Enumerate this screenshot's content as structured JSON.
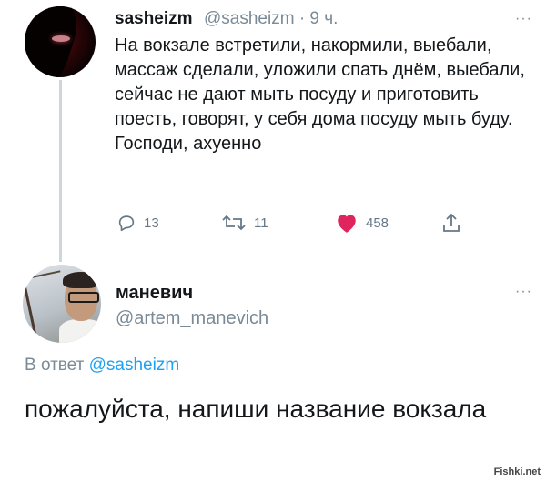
{
  "tweet": {
    "display_name": "sasheizm",
    "handle_time": "@sasheizm · 9 ч.",
    "more": "···",
    "text": "На вокзале встретили, накормили, выебали, массаж сделали, уложили спать днём, выебали, сейчас не дают мыть посуду и приготовить поесть, говорят, у себя дома посуду мыть буду. Господи, ахуенно",
    "actions": {
      "replies": "13",
      "retweets": "11",
      "likes": "458"
    },
    "like_color": "#e0245e"
  },
  "reply": {
    "display_name": "маневич",
    "handle": "@artem_manevich",
    "more": "···",
    "replying_prefix": "В ответ",
    "replying_mention": "@sasheizm",
    "text": "пожалуйста, напиши название вокзала"
  },
  "watermark": "Fishki.net",
  "colors": {
    "accent": "#1da1f2",
    "muted": "#657786",
    "line": "#ccd6dd"
  }
}
